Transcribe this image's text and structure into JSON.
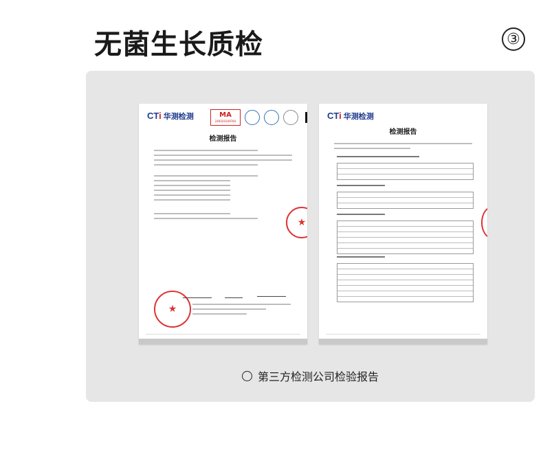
{
  "page": {
    "title": "无菌生长质检",
    "step": "③"
  },
  "report1": {
    "logo_prefix": "CT",
    "logo_accent": "i",
    "logo_cn": "华测检测",
    "cma_label": "MA",
    "cma_number": "240020349784",
    "heading": "检测报告"
  },
  "report2": {
    "logo_prefix": "CT",
    "logo_accent": "i",
    "logo_cn": "华测检测",
    "heading": "检测报告"
  },
  "caption": "第三方检测公司检验报告",
  "colors": {
    "panel": "#e6e6e6",
    "stamp": "#dd3333",
    "logo": "#1f3b8c"
  }
}
